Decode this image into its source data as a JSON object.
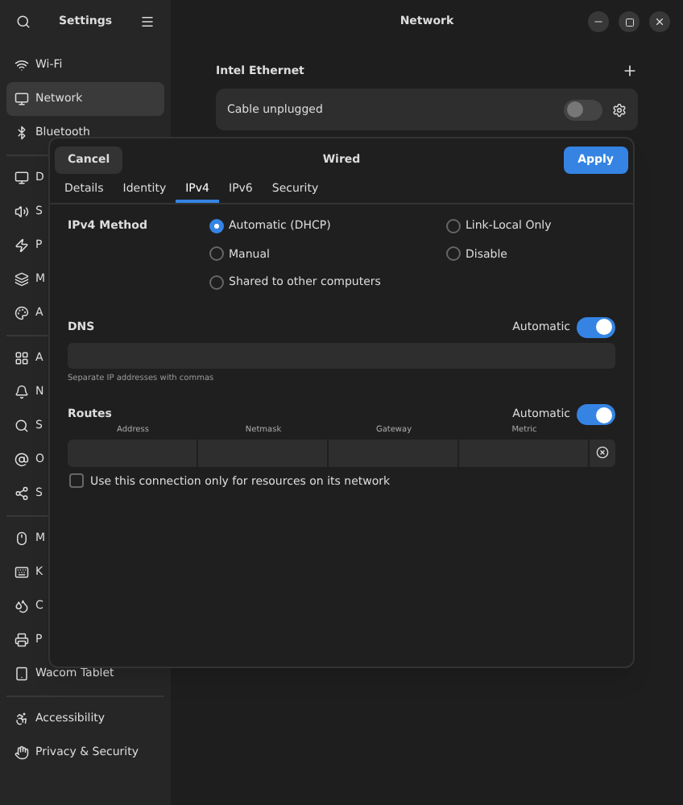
{
  "sidebar": {
    "title": "Settings",
    "groups": [
      [
        {
          "label": "Wi-Fi",
          "selected": false
        },
        {
          "label": "Network",
          "selected": true
        },
        {
          "label": "Bluetooth",
          "selected": false
        }
      ],
      [
        {
          "label": "D",
          "selected": false
        },
        {
          "label": "S",
          "selected": false
        },
        {
          "label": "P",
          "selected": false
        },
        {
          "label": "M",
          "selected": false
        },
        {
          "label": "A",
          "selected": false
        }
      ],
      [
        {
          "label": "A",
          "selected": false
        },
        {
          "label": "N",
          "selected": false
        },
        {
          "label": "S",
          "selected": false
        },
        {
          "label": "O",
          "selected": false
        },
        {
          "label": "S",
          "selected": false
        }
      ],
      [
        {
          "label": "M",
          "selected": false
        },
        {
          "label": "K",
          "selected": false
        },
        {
          "label": "C",
          "selected": false
        },
        {
          "label": "P",
          "selected": false
        },
        {
          "label": "Wacom Tablet",
          "selected": false
        }
      ],
      [
        {
          "label": "Accessibility",
          "selected": false
        },
        {
          "label": "Privacy & Security",
          "selected": false
        }
      ]
    ]
  },
  "window": {
    "title": "Network"
  },
  "device": {
    "name": "Intel Ethernet",
    "status": "Cable unplugged",
    "on": false
  },
  "dialog": {
    "title": "Wired",
    "cancel": "Cancel",
    "apply": "Apply",
    "tabs": [
      {
        "label": "Details",
        "selected": false
      },
      {
        "label": "Identity",
        "selected": false
      },
      {
        "label": "IPv4",
        "selected": true
      },
      {
        "label": "IPv6",
        "selected": false
      },
      {
        "label": "Security",
        "selected": false
      }
    ],
    "method": {
      "label": "IPv4 Method",
      "options": [
        {
          "label": "Automatic (DHCP)",
          "selected": true
        },
        {
          "label": "Link-Local Only",
          "selected": false
        },
        {
          "label": "Manual",
          "selected": false
        },
        {
          "label": "Disable",
          "selected": false
        },
        {
          "label": "Shared to other computers",
          "selected": false
        }
      ]
    },
    "dns": {
      "label": "DNS",
      "auto_label": "Automatic",
      "on": true,
      "hint": "Separate IP addresses with commas"
    },
    "routes": {
      "label": "Routes",
      "auto_label": "Automatic",
      "on": true,
      "columns": [
        "Address",
        "Netmask",
        "Gateway",
        "Metric"
      ]
    },
    "only_local": {
      "label": "Use this connection only for resources on its network",
      "checked": false
    }
  }
}
